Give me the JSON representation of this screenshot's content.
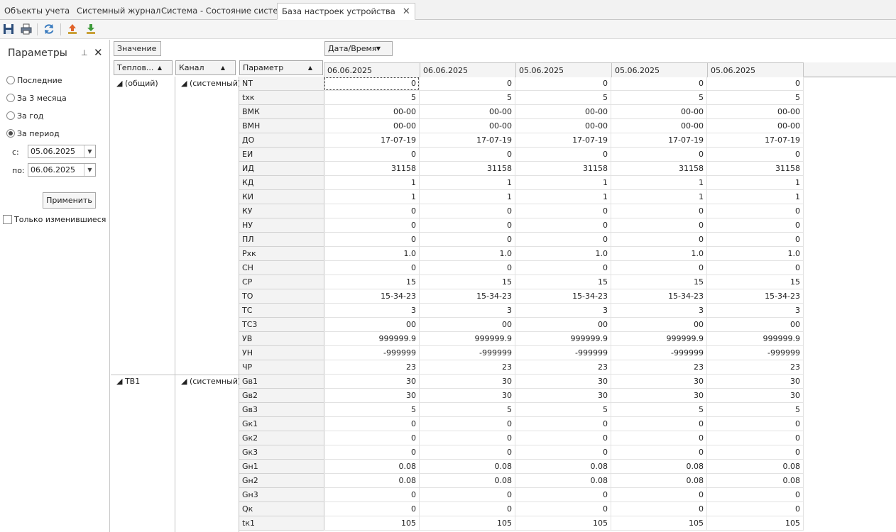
{
  "tabs": [
    {
      "label": "Объекты учета"
    },
    {
      "label": "Системный журнал"
    },
    {
      "label": "Система - Состояние системы"
    },
    {
      "label": "База настроек устройства",
      "active": true
    }
  ],
  "toolbar": {
    "icons": [
      "save-icon",
      "print-icon",
      "refresh-icon",
      "export-icon",
      "import-icon"
    ]
  },
  "panel": {
    "title": "Параметры",
    "period_options": [
      {
        "label": "Последние",
        "selected": false
      },
      {
        "label": "За 3 месяца",
        "selected": false
      },
      {
        "label": "За год",
        "selected": false
      },
      {
        "label": "За период",
        "selected": true
      }
    ],
    "from_label": "с:",
    "from_value": "05.06.2025",
    "to_label": "по:",
    "to_value": "06.06.2025",
    "apply_label": "Применить",
    "only_changed_label": "Только изменившиеся"
  },
  "grid": {
    "data_field": "Значение",
    "column_field": "Дата/Время",
    "row_fields": [
      "Теплов...",
      "Канал",
      "Параметр"
    ],
    "columns": [
      "06.06.2025",
      "06.06.2025",
      "05.06.2025",
      "05.06.2025",
      "05.06.2025"
    ],
    "groups": [
      {
        "name": "(общий)",
        "channel": "(системный)",
        "rows": [
          {
            "param": "NT",
            "value": "0"
          },
          {
            "param": "tхк",
            "value": "5"
          },
          {
            "param": "ВМК",
            "value": "00-00"
          },
          {
            "param": "ВМН",
            "value": "00-00"
          },
          {
            "param": "ДО",
            "value": "17-07-19"
          },
          {
            "param": "ЕИ",
            "value": "0"
          },
          {
            "param": "ИД",
            "value": "31158"
          },
          {
            "param": "КД",
            "value": "1"
          },
          {
            "param": "КИ",
            "value": "1"
          },
          {
            "param": "КУ",
            "value": "0"
          },
          {
            "param": "НУ",
            "value": "0"
          },
          {
            "param": "ПЛ",
            "value": "0"
          },
          {
            "param": "Рхк",
            "value": "1.0"
          },
          {
            "param": "СН",
            "value": "0"
          },
          {
            "param": "СР",
            "value": "15"
          },
          {
            "param": "ТО",
            "value": "15-34-23"
          },
          {
            "param": "ТС",
            "value": "3"
          },
          {
            "param": "ТС3",
            "value": "00"
          },
          {
            "param": "УВ",
            "value": "999999.9"
          },
          {
            "param": "УН",
            "value": "-999999"
          },
          {
            "param": "ЧР",
            "value": "23"
          }
        ]
      },
      {
        "name": "ТВ1",
        "channel": "(системный)",
        "rows": [
          {
            "param": "Gв1",
            "value": "30"
          },
          {
            "param": "Gв2",
            "value": "30"
          },
          {
            "param": "Gв3",
            "value": "5"
          },
          {
            "param": "Gк1",
            "value": "0"
          },
          {
            "param": "Gк2",
            "value": "0"
          },
          {
            "param": "Gк3",
            "value": "0"
          },
          {
            "param": "Gн1",
            "value": "0.08"
          },
          {
            "param": "Gн2",
            "value": "0.08"
          },
          {
            "param": "Gн3",
            "value": "0"
          },
          {
            "param": "Qк",
            "value": "0"
          },
          {
            "param": "tк1",
            "value": "105"
          }
        ]
      }
    ]
  }
}
